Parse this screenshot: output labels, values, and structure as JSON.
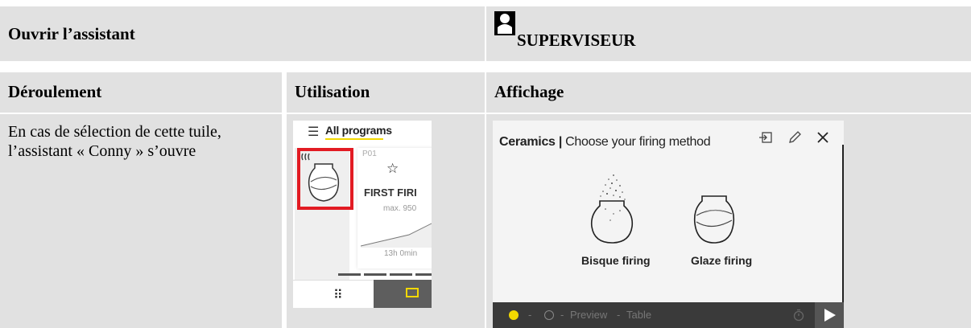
{
  "header": {
    "open_assistant": "Ouvrir l’assistant",
    "role_label": "SUPERVISEUR",
    "role_icon": "person-icon"
  },
  "columns": {
    "sequence": "Déroulement",
    "usage": "Utilisation",
    "display": "Affichage"
  },
  "sequence_text": "En cas de sélection de cette tuile, l’assistant « Conny » s’ouvre",
  "usage_screen": {
    "list_title": "All programs",
    "program_number": "P01",
    "program_name": "FIRST FIRI",
    "max_temp": "max. 950",
    "duration": "13h 0min",
    "accent_color": "#f2d800",
    "highlight_color": "#e21b23"
  },
  "display_screen": {
    "category": "Ceramics",
    "separator": "|",
    "title": "Choose your firing method",
    "methods": [
      "Bisque firing",
      "Glaze firing"
    ],
    "footer_items": [
      "Preview",
      "Table"
    ],
    "footer_separator": "-"
  },
  "colors": {
    "header_bg": "#e1e1e1",
    "grid_line": "#ffffff"
  }
}
